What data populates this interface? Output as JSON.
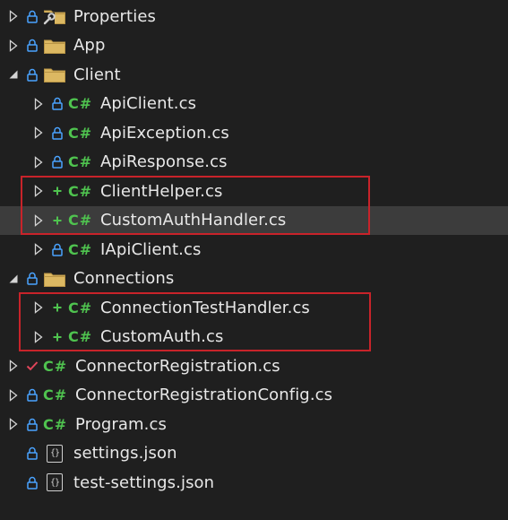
{
  "explorer": {
    "items": [
      {
        "label": "Properties",
        "depth": 0,
        "expander": "collapsed",
        "status": "lock",
        "icon": "wrench-folder-icon"
      },
      {
        "label": "App",
        "depth": 0,
        "expander": "collapsed",
        "status": "lock",
        "icon": "folder-icon"
      },
      {
        "label": "Client",
        "depth": 0,
        "expander": "expanded",
        "status": "lock",
        "icon": "folder-icon"
      },
      {
        "label": "ApiClient.cs",
        "depth": 1,
        "expander": "collapsed",
        "status": "lock",
        "icon": "csharp-file-icon"
      },
      {
        "label": "ApiException.cs",
        "depth": 1,
        "expander": "collapsed",
        "status": "lock",
        "icon": "csharp-file-icon"
      },
      {
        "label": "ApiResponse.cs",
        "depth": 1,
        "expander": "collapsed",
        "status": "lock",
        "icon": "csharp-file-icon"
      },
      {
        "label": "ClientHelper.cs",
        "depth": 1,
        "expander": "collapsed",
        "status": "add",
        "icon": "csharp-file-icon"
      },
      {
        "label": "CustomAuthHandler.cs",
        "depth": 1,
        "expander": "collapsed",
        "status": "add",
        "icon": "csharp-file-icon",
        "selected": true
      },
      {
        "label": "IApiClient.cs",
        "depth": 1,
        "expander": "collapsed",
        "status": "lock",
        "icon": "csharp-file-icon"
      },
      {
        "label": "Connections",
        "depth": 0,
        "expander": "expanded",
        "status": "lock",
        "icon": "folder-icon"
      },
      {
        "label": "ConnectionTestHandler.cs",
        "depth": 1,
        "expander": "collapsed",
        "status": "add",
        "icon": "csharp-file-icon"
      },
      {
        "label": "CustomAuth.cs",
        "depth": 1,
        "expander": "collapsed",
        "status": "add",
        "icon": "csharp-file-icon"
      },
      {
        "label": "ConnectorRegistration.cs",
        "depth": 0,
        "expander": "collapsed",
        "status": "check",
        "icon": "csharp-file-icon"
      },
      {
        "label": "ConnectorRegistrationConfig.cs",
        "depth": 0,
        "expander": "collapsed",
        "status": "lock",
        "icon": "csharp-file-icon"
      },
      {
        "label": "Program.cs",
        "depth": 0,
        "expander": "collapsed",
        "status": "lock",
        "icon": "csharp-file-icon"
      },
      {
        "label": "settings.json",
        "depth": 0,
        "expander": "none",
        "status": "lock",
        "icon": "json-file-icon"
      },
      {
        "label": "test-settings.json",
        "depth": 0,
        "expander": "none",
        "status": "lock",
        "icon": "json-file-icon"
      }
    ]
  },
  "glyphs": {
    "csharp": "C#",
    "json": "{}"
  },
  "colors": {
    "background": "#1f1f1f",
    "selected_row": "#3c3c3c",
    "lock": "#4aa3ff",
    "add": "#4fc34f",
    "check": "#e0455a",
    "csharp": "#4fc34f",
    "folder": "#dcb862",
    "highlight_border": "#c8232a"
  }
}
